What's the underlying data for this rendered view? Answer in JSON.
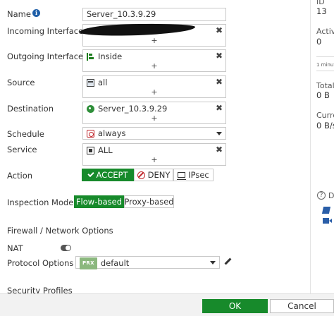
{
  "form": {
    "name": {
      "label": "Name",
      "value": "Server_10.3.9.29"
    },
    "incoming_interface": {
      "label": "Incoming Interface"
    },
    "outgoing_interface": {
      "label": "Outgoing Interface",
      "value": "Inside"
    },
    "source": {
      "label": "Source",
      "value": "all"
    },
    "destination": {
      "label": "Destination",
      "value": "Server_10.3.9.29"
    },
    "schedule": {
      "label": "Schedule",
      "value": "always"
    },
    "service": {
      "label": "Service",
      "value": "ALL"
    },
    "action": {
      "label": "Action",
      "options": [
        "ACCEPT",
        "DENY",
        "IPsec"
      ],
      "selected": "ACCEPT"
    },
    "inspection_mode": {
      "label": "Inspection Mode",
      "options": [
        "Flow-based",
        "Proxy-based"
      ],
      "selected": "Flow-based"
    },
    "remove_symbol": "✖",
    "add_symbol": "+"
  },
  "sections": {
    "firewall_network_options": "Firewall / Network Options",
    "security_profiles": "Security Profiles"
  },
  "nat": {
    "label": "NAT",
    "enabled": false
  },
  "protocol_options": {
    "label": "Protocol Options",
    "badge": "PRX",
    "value": "default"
  },
  "right_panel": {
    "id_label": "ID",
    "id_value": "13",
    "active_label": "Activ",
    "active_value": "0",
    "minute_label": "1 minute",
    "total_label": "Total",
    "total_value": "0 B",
    "current_label": "Curre",
    "current_value": "0 B/s",
    "help_label": "D",
    "help_symbol": "?"
  },
  "footer": {
    "ok_label": "OK",
    "cancel_label": "Cancel"
  },
  "colors": {
    "accept_green": "#178a2b",
    "deny_red": "#c0282d",
    "info_blue": "#1f5fa8"
  },
  "icons": [
    "info-icon",
    "interface-icon",
    "address-icon",
    "vip-icon",
    "schedule-icon",
    "service-icon",
    "check-icon",
    "deny-icon",
    "monitor-icon",
    "edit-pencil-icon",
    "help-icon",
    "book-icon",
    "video-icon",
    "toggle-icon"
  ]
}
